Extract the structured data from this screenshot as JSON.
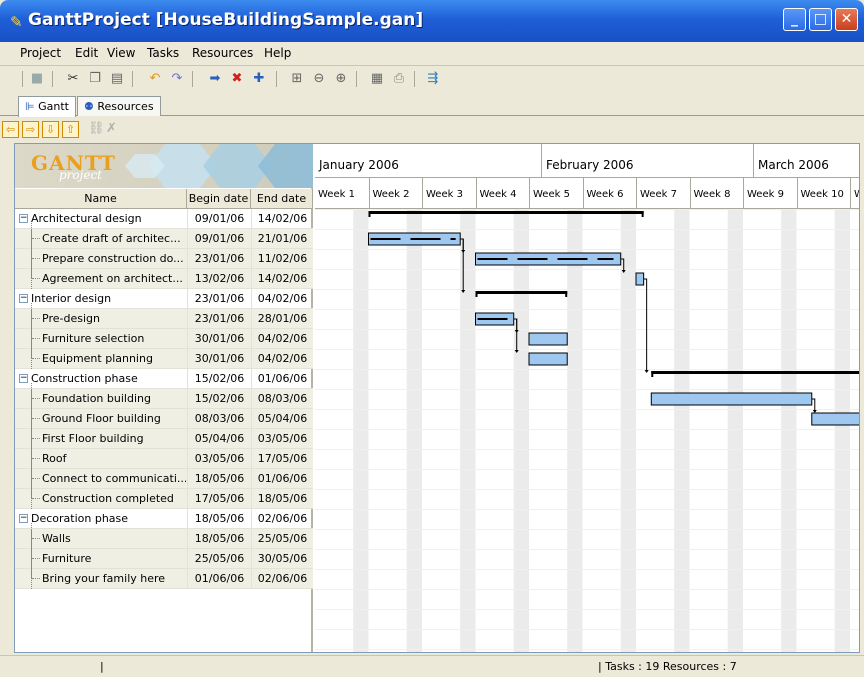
{
  "window": {
    "title": "GanttProject [HouseBuildingSample.gan]"
  },
  "menu": [
    "Project",
    "Edit",
    "View",
    "Tasks",
    "Resources",
    "Help"
  ],
  "toolbar": {
    "icons": [
      "save-icon",
      "cut-icon",
      "copy-icon",
      "paste-icon",
      "undo-icon",
      "redo-icon",
      "indent-icon",
      "delete-icon",
      "new-task-icon",
      "fit-icon",
      "zoom-out-icon",
      "zoom-in-icon",
      "preview-icon",
      "print-icon",
      "critical-path-icon"
    ]
  },
  "tabs": [
    {
      "label": "Gantt",
      "active": true
    },
    {
      "label": "Resources",
      "active": false
    }
  ],
  "logo": {
    "text": "GANTT",
    "sub": "project"
  },
  "table": {
    "headers": {
      "name": "Name",
      "begin": "Begin date",
      "end": "End date"
    },
    "rows": [
      {
        "name": "Architectural design",
        "begin": "09/01/06",
        "end": "14/02/06",
        "level": 0
      },
      {
        "name": "Create draft of architec...",
        "begin": "09/01/06",
        "end": "21/01/06",
        "level": 1
      },
      {
        "name": "Prepare construction do...",
        "begin": "23/01/06",
        "end": "11/02/06",
        "level": 1
      },
      {
        "name": "Agreement on architect...",
        "begin": "13/02/06",
        "end": "14/02/06",
        "level": 1
      },
      {
        "name": "Interior design",
        "begin": "23/01/06",
        "end": "04/02/06",
        "level": 0
      },
      {
        "name": "Pre-design",
        "begin": "23/01/06",
        "end": "28/01/06",
        "level": 1
      },
      {
        "name": "Furniture selection",
        "begin": "30/01/06",
        "end": "04/02/06",
        "level": 1
      },
      {
        "name": "Equipment planning",
        "begin": "30/01/06",
        "end": "04/02/06",
        "level": 1
      },
      {
        "name": "Construction phase",
        "begin": "15/02/06",
        "end": "01/06/06",
        "level": 0
      },
      {
        "name": "Foundation building",
        "begin": "15/02/06",
        "end": "08/03/06",
        "level": 1
      },
      {
        "name": "Ground Floor building",
        "begin": "08/03/06",
        "end": "05/04/06",
        "level": 1
      },
      {
        "name": "First Floor building",
        "begin": "05/04/06",
        "end": "03/05/06",
        "level": 1
      },
      {
        "name": "Roof",
        "begin": "03/05/06",
        "end": "17/05/06",
        "level": 1
      },
      {
        "name": "Connect to communicati...",
        "begin": "18/05/06",
        "end": "01/06/06",
        "level": 1
      },
      {
        "name": "Construction completed",
        "begin": "17/05/06",
        "end": "18/05/06",
        "level": 1
      },
      {
        "name": "Decoration phase",
        "begin": "18/05/06",
        "end": "02/06/06",
        "level": 0
      },
      {
        "name": "Walls",
        "begin": "18/05/06",
        "end": "25/05/06",
        "level": 1
      },
      {
        "name": "Furniture",
        "begin": "25/05/06",
        "end": "30/05/06",
        "level": 1
      },
      {
        "name": "Bring your family here",
        "begin": "01/06/06",
        "end": "02/06/06",
        "level": 1
      }
    ]
  },
  "timeline": {
    "months": [
      "January 2006",
      "February 2006",
      "March 2006"
    ],
    "weeks": [
      "Week 1",
      "Week 2",
      "Week 3",
      "Week 4",
      "Week 5",
      "Week 6",
      "Week 7",
      "Week 8",
      "Week 9",
      "Week 10",
      "W"
    ]
  },
  "status": {
    "left": "|",
    "right": "| Tasks : 19 Resources : 7"
  },
  "colors": {
    "bar": "#9ec8f0",
    "summary": "#000000",
    "weekend": "#ebebeb"
  }
}
